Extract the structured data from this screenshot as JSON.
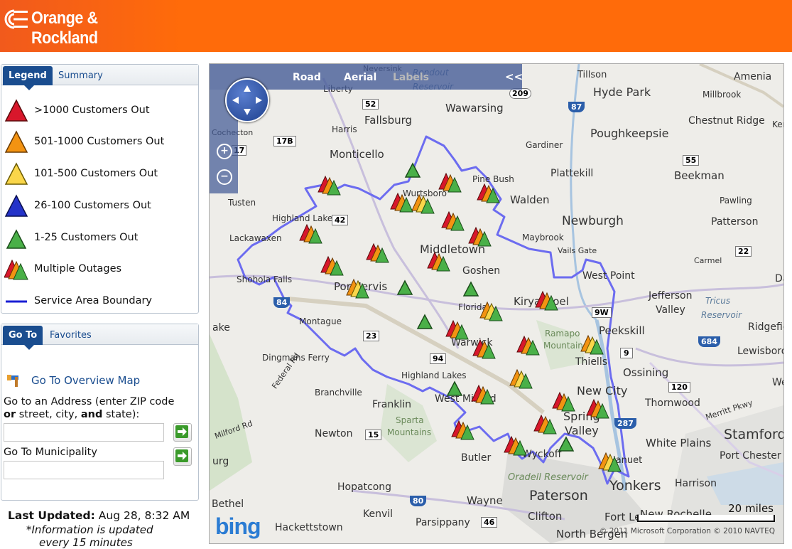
{
  "header": {
    "logo_text": "Orange & Rockland",
    "logo_icon": "orange-rockland-logo-icon",
    "background": "#ff6b0a"
  },
  "legend_panel": {
    "tabs": [
      {
        "label": "Legend",
        "active": true
      },
      {
        "label": "Summary",
        "active": false
      }
    ],
    "items": [
      {
        "label": ">1000 Customers Out",
        "icon": "red-triangle-icon",
        "color": "#d8172b"
      },
      {
        "label": "501-1000 Customers Out",
        "icon": "orange-triangle-icon",
        "color": "#f39312"
      },
      {
        "label": "101-500 Customers Out",
        "icon": "yellow-triangle-icon",
        "color": "#fad64a"
      },
      {
        "label": "26-100 Customers Out",
        "icon": "blue-triangle-icon",
        "color": "#2433c9"
      },
      {
        "label": "1-25 Customers Out",
        "icon": "green-triangle-icon",
        "color": "#4ab048"
      },
      {
        "label": "Multiple Outages",
        "icon": "multiple-outages-icon"
      },
      {
        "label": "Service Area Boundary",
        "icon": "boundary-line-icon",
        "color": "#1a1fd4"
      }
    ]
  },
  "goto_panel": {
    "tabs": [
      {
        "label": "Go To",
        "active": true
      },
      {
        "label": "Favorites",
        "active": false
      }
    ],
    "overview_link": "Go To Overview Map",
    "address_label_1": "Go to an Address (enter ZIP code",
    "address_label_2a": "or",
    "address_label_2b": " street, city, ",
    "address_label_2c": "and",
    "address_label_2d": " state):",
    "address_value": "",
    "municipality_label": "Go To Municipality",
    "municipality_value": ""
  },
  "footer": {
    "last_updated_label": "Last Updated:",
    "last_updated_value": "Aug 28, 8:32 AM",
    "note_line1": "*Information is updated",
    "note_line2": "every 15 minutes"
  },
  "map": {
    "nav": {
      "road": "Road",
      "aerial": "Aerial",
      "labels": "Labels",
      "collapse": "<<"
    },
    "scale_label": "20 miles",
    "copyright": "© 2011 Microsoft Corporation  © 2010 NAVTEQ",
    "brand": "bing",
    "boundary_color": "#6c6cf0",
    "places": [
      "Tillson",
      "Hyde Park",
      "Amenia",
      "Millbrook",
      "Wawarsing",
      "Fallsburg",
      "Liberty",
      "Harris",
      "Poughkeepsie",
      "Chestnut Ridge",
      "Monticello",
      "Gardiner",
      "Plattekill",
      "Beekman",
      "Pine Bush",
      "Walden",
      "Tusten",
      "Highland Lake",
      "Wurtsboro",
      "Newburgh",
      "Pawling",
      "Patterson",
      "Lackawaxen",
      "Maybrook",
      "Middletown",
      "Vails Gate",
      "Carmel",
      "Shohola Falls",
      "Goshen",
      "West Point",
      "Jefferson Valley",
      "Port Jervis",
      "Kiryas Joel",
      "Florida",
      "Peekskill",
      "Ridgefield",
      "Montague",
      "Ramapo Mountains",
      "Lewisboro",
      "Warwick",
      "Thiells",
      "Ossining",
      "Dingmans Ferry",
      "Highland Lakes",
      "New City",
      "Thornwood",
      "Branchville",
      "West Milford",
      "Spring Valley",
      "Franklin",
      "Sparta Mountains",
      "Newton",
      "Stamford",
      "White Plains",
      "Port Chester",
      "Butler",
      "Wyckoff",
      "Nanuet",
      "Yonkers",
      "Harrison",
      "Oradell Reservoir",
      "Hopatcong",
      "Wayne",
      "Paterson",
      "Kenvil",
      "Clifton",
      "Fort Lee",
      "New Rochelle",
      "Bethel",
      "Hackettstown",
      "Parsippany",
      "North Bergen",
      "Tricus Reservoir",
      "Neversink",
      "Rondout Reservoir",
      "Cochecton",
      "Federal Rd",
      "Milford Rd",
      "Merritt Pkwy"
    ],
    "routes": [
      "209",
      "52",
      "87",
      "17B",
      "17",
      "42",
      "55",
      "22",
      "84",
      "9W",
      "23",
      "684",
      "94",
      "9",
      "120",
      "15",
      "287",
      "80",
      "46"
    ]
  }
}
